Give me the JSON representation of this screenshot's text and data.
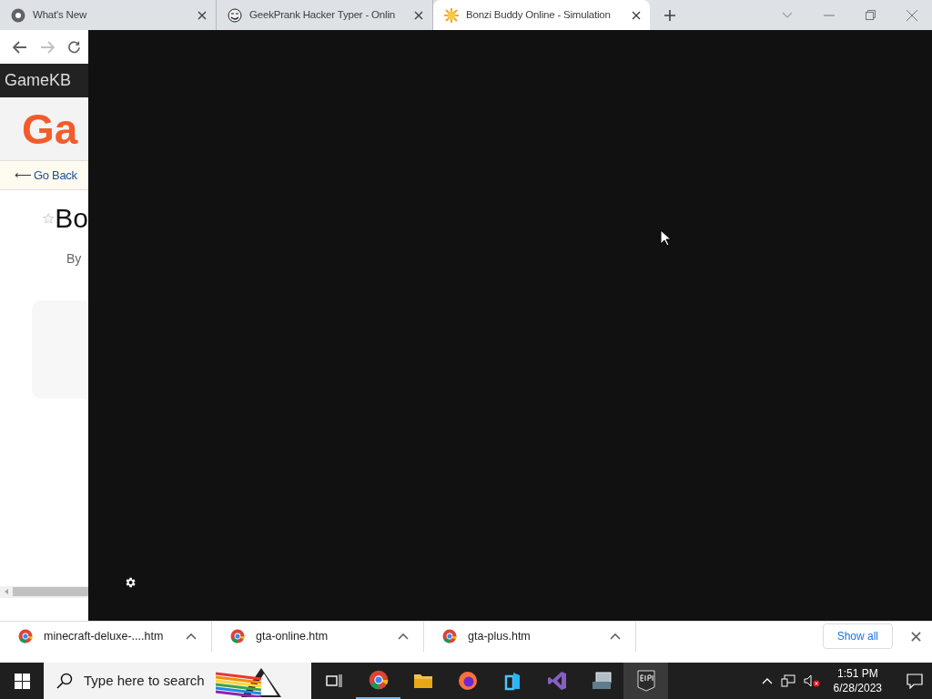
{
  "tabs": [
    {
      "kind": "chrome",
      "label": "What's New",
      "selected": false
    },
    {
      "kind": "face",
      "label": "GeekPrank Hacker Typer - Onlin",
      "selected": false
    },
    {
      "kind": "sun",
      "label": "Bonzi Buddy Online - Simulation",
      "selected": true
    }
  ],
  "page": {
    "site_bar": "GameKB",
    "logo": "Ga",
    "back_link": "Go Back",
    "back_arrow": "⟵",
    "title": "Bo",
    "byline": "By"
  },
  "downloads": {
    "items": [
      {
        "name": "minecraft-deluxe-....htm"
      },
      {
        "name": "gta-online.htm"
      },
      {
        "name": "gta-plus.htm"
      }
    ],
    "show_all": "Show all"
  },
  "taskbar": {
    "search_placeholder": "Type here to search",
    "apps": [
      {
        "kind": "taskview",
        "active": false
      },
      {
        "kind": "chrome",
        "active": true
      },
      {
        "kind": "folder",
        "active": false
      },
      {
        "kind": "firefox",
        "active": false
      },
      {
        "kind": "app",
        "active": false
      },
      {
        "kind": "vs",
        "active": false
      },
      {
        "kind": "pc",
        "active": false
      },
      {
        "kind": "epic",
        "active": false,
        "selected": true
      }
    ],
    "time": "1:51 PM",
    "date": "6/28/2023"
  }
}
